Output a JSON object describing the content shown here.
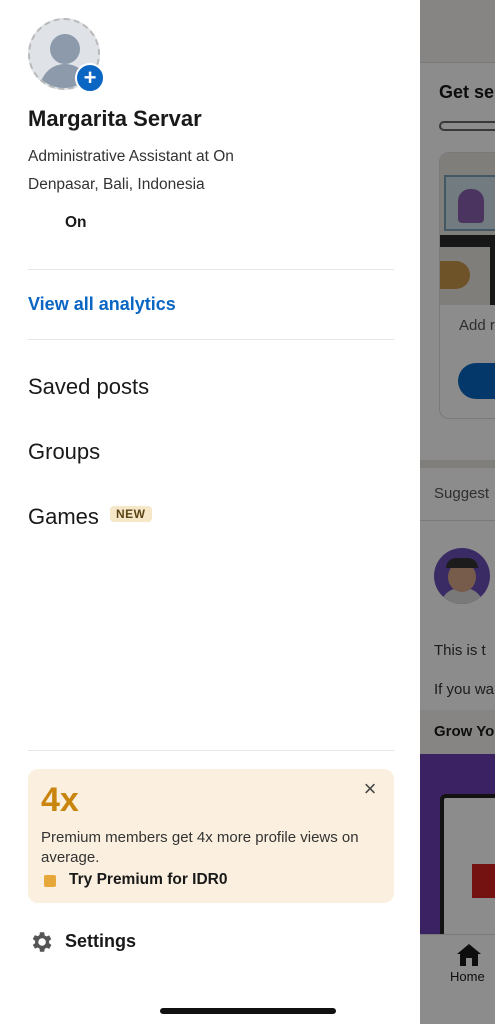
{
  "profile": {
    "name": "Margarita Servar",
    "headline": "Administrative Assistant at On",
    "location": "Denpasar, Bali, Indonesia",
    "company": "On"
  },
  "analytics_link": "View all analytics",
  "menu": {
    "saved_posts": "Saved posts",
    "groups": "Groups",
    "games": "Games",
    "games_badge": "NEW"
  },
  "premium": {
    "multiplier": "4x",
    "message": "Premium members get 4x more profile views on average.",
    "cta": "Try Premium for IDR0",
    "close_icon": "×"
  },
  "settings": {
    "label": "Settings",
    "icon": "gear-icon"
  },
  "background_feed": {
    "card_title": "Get se",
    "card_text": "Add r",
    "suggested": "Suggest",
    "post_text_1": "This is t",
    "post_text_2": "If you wa",
    "grow": "Grow Yo",
    "home_label": "Home"
  },
  "colors": {
    "accent_blue": "#0a66c2",
    "premium_bg": "#fbf0df",
    "premium_accent": "#c9850f"
  }
}
